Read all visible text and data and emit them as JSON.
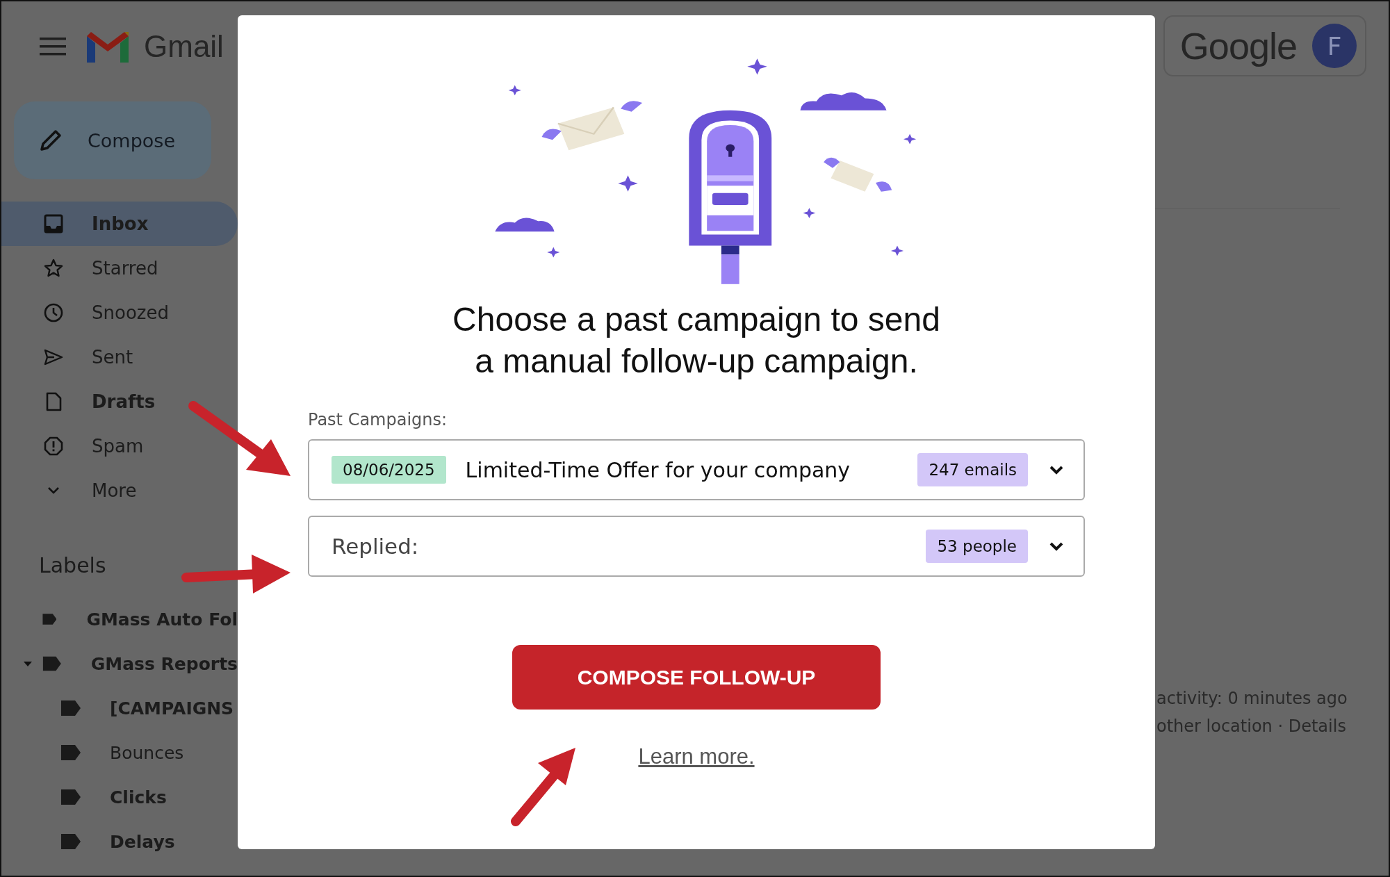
{
  "sidebar": {
    "app_name": "Gmail",
    "compose_button": "Compose",
    "items": [
      {
        "label": "Inbox",
        "selected": true,
        "unread": true
      },
      {
        "label": "Starred",
        "selected": false,
        "unread": false
      },
      {
        "label": "Snoozed",
        "selected": false,
        "unread": false
      },
      {
        "label": "Sent",
        "selected": false,
        "unread": false
      },
      {
        "label": "Drafts",
        "selected": false,
        "unread": true
      },
      {
        "label": "Spam",
        "selected": false,
        "unread": false
      },
      {
        "label": "More",
        "selected": false,
        "unread": false
      }
    ],
    "labels_heading": "Labels",
    "labels": [
      {
        "label": "GMass Auto Fol",
        "unread": true
      },
      {
        "label": "GMass Reports",
        "unread": true,
        "expanded": true,
        "children": [
          {
            "label": "[CAMPAIGNS",
            "unread": true
          },
          {
            "label": "Bounces",
            "unread": false
          },
          {
            "label": "Clicks",
            "unread": true
          },
          {
            "label": "Delays",
            "unread": true
          }
        ]
      }
    ]
  },
  "account": {
    "brand": "Google",
    "avatar_initial": "F"
  },
  "background_text": [
    "activity: 0 minutes ago",
    "other location · Details"
  ],
  "dialog": {
    "title_lines": [
      "Choose a past campaign to send",
      "a manual follow-up campaign."
    ],
    "field_label": "Past Campaigns:",
    "campaign_select": {
      "date": "08/06/2025",
      "subject": "Limited-Time Offer for your company",
      "count": "247 emails"
    },
    "filter_select": {
      "label": "Replied:",
      "count": "53 people"
    },
    "primary_button": "COMPOSE FOLLOW-UP",
    "link": "Learn more."
  }
}
